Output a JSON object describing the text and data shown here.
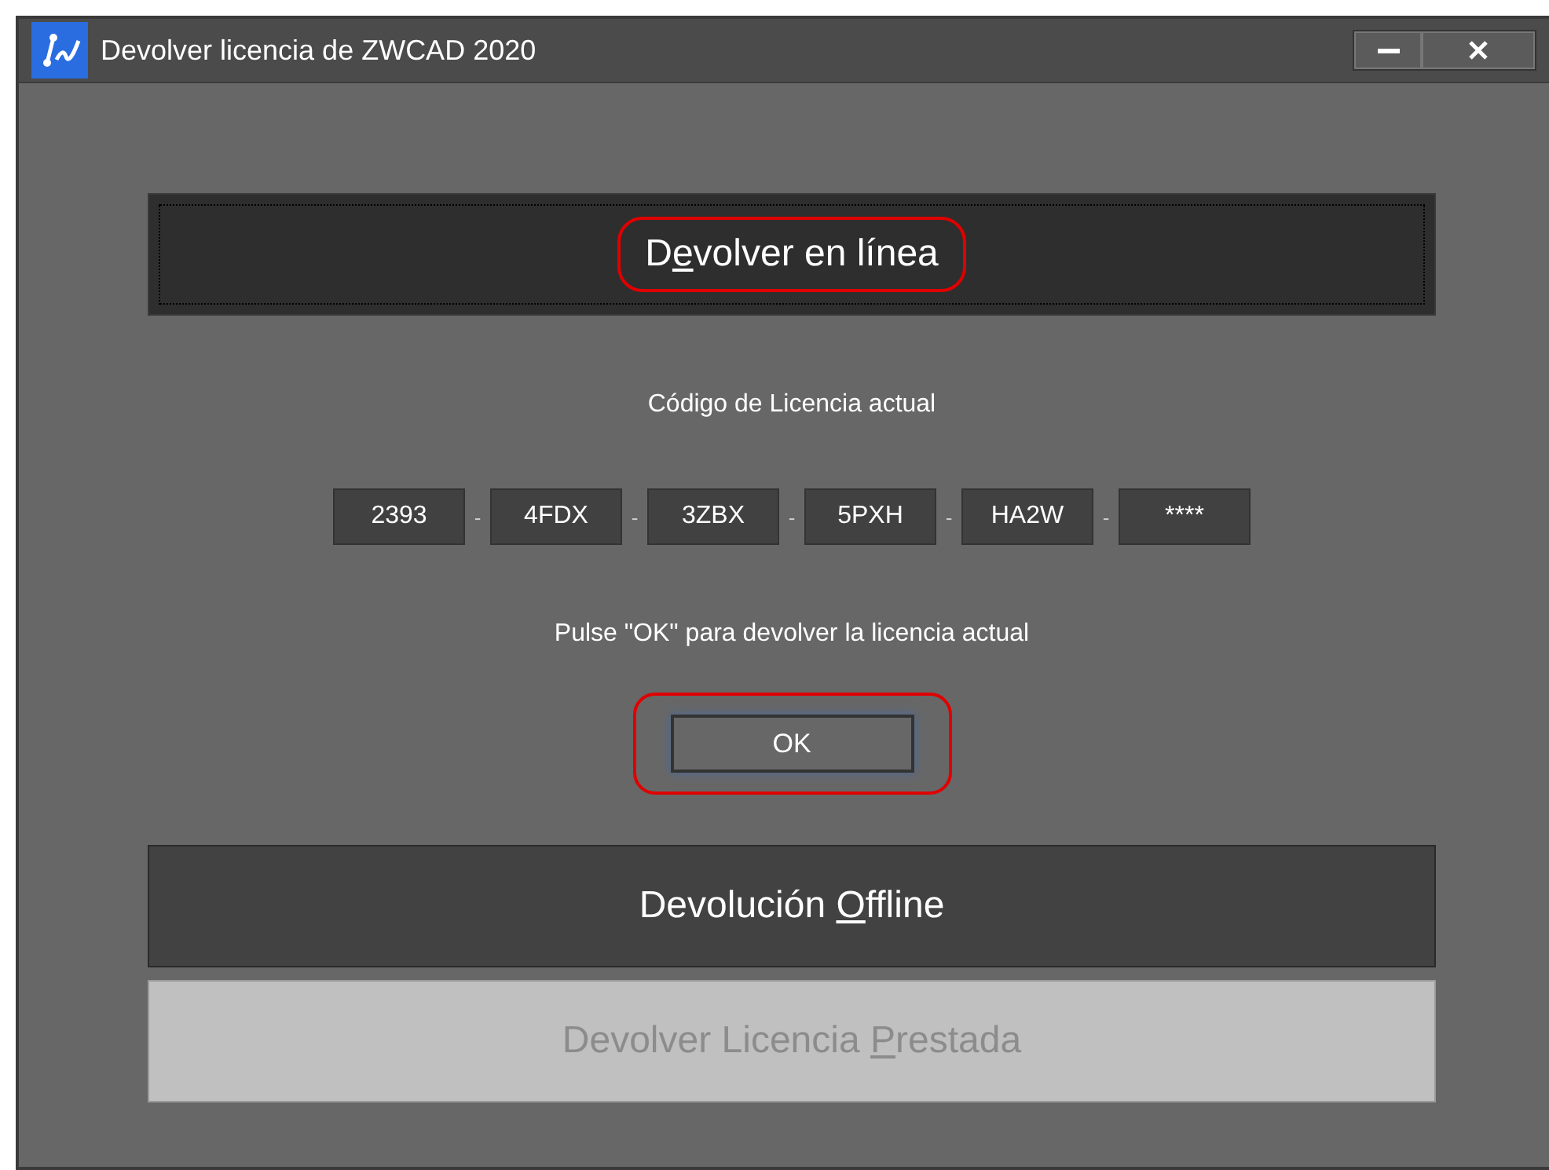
{
  "window": {
    "title": "Devolver licencia de ZWCAD 2020"
  },
  "sections": [
    {
      "label": {
        "before": "D",
        "key": "e",
        "after": "volver en línea"
      },
      "expanded": true,
      "focused": true,
      "highlighted": true,
      "disabled": false
    },
    {
      "label": {
        "before": "Devolución ",
        "key": "O",
        "after": "ffline"
      },
      "expanded": false,
      "focused": false,
      "highlighted": false,
      "disabled": false
    },
    {
      "label": {
        "before": "Devolver Licencia ",
        "key": "P",
        "after": "restada"
      },
      "expanded": false,
      "focused": false,
      "highlighted": false,
      "disabled": true
    }
  ],
  "online": {
    "code_label": "Código de Licencia actual",
    "code_segments": [
      "2393",
      "4FDX",
      "3ZBX",
      "5PXH",
      "HA2W",
      "****"
    ],
    "separator": "-",
    "instruction": "Pulse \"OK\" para devolver la licencia actual",
    "ok_button": {
      "label": "OK",
      "highlighted": true
    }
  }
}
